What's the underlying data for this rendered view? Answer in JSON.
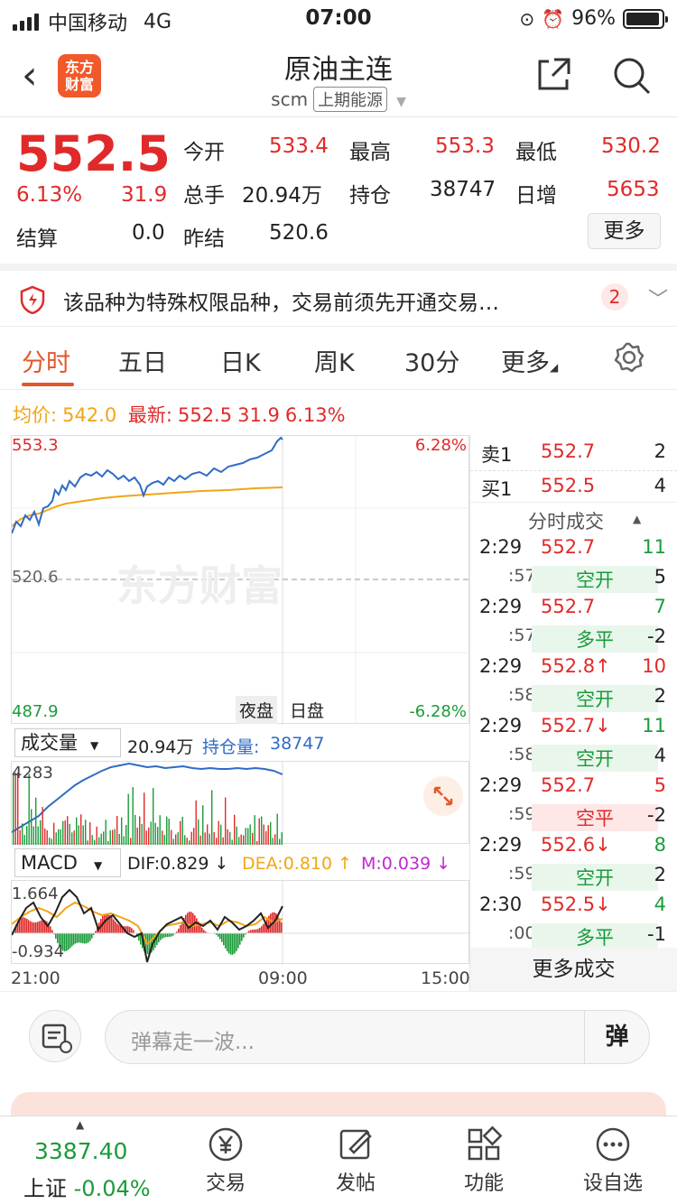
{
  "status_bar": {
    "carrier": "中国移动",
    "network": "4G",
    "time": "07:00",
    "battery": "96%"
  },
  "nav": {
    "logo": "东方\n财富",
    "title": "原油主连",
    "code": "scm",
    "exchange": "上期能源"
  },
  "quote": {
    "price": "552.5",
    "change_pct": "6.13%",
    "change": "31.9",
    "settle_label": "结算",
    "settle": "0.0",
    "open_label": "今开",
    "open": "533.4",
    "volume_label": "总手",
    "volume": "20.94万",
    "prev_settle_label": "昨结",
    "prev_settle": "520.6",
    "high_label": "最高",
    "high": "553.3",
    "oi_label": "持仓",
    "oi": "38747",
    "low_label": "最低",
    "low": "530.2",
    "daily_inc_label": "日增",
    "daily_inc": "5653",
    "more_label": "更多"
  },
  "notice": {
    "text": "该品种为特殊权限品种，交易前须先开通交易…",
    "badge": "2"
  },
  "tabs": [
    "分时",
    "五日",
    "日K",
    "周K",
    "30分",
    "更多"
  ],
  "avg_line": {
    "avg_label": "均价:",
    "avg": "542.0",
    "latest_label": "最新:",
    "latest": "552.5",
    "chg": "31.9",
    "pct": "6.13%"
  },
  "chart": {
    "top_left": "553.3",
    "mid_left": "520.6",
    "bottom_left": "487.9",
    "top_right": "6.28%",
    "bottom_right": "-6.28%",
    "watermark": "东方财富",
    "night": "夜盘",
    "day": "日盘",
    "vol_selector": "成交量",
    "vol_value": "20.94万",
    "oi_label": "持仓量:",
    "oi_value": "38747",
    "vol_max": "4283",
    "macd_selector": "MACD",
    "dif": "DIF:0.829 ↓",
    "dea": "DEA:0.810 ↑",
    "m": "M:0.039 ↓",
    "macd_top": "1.664",
    "macd_bottom": "-0.934",
    "x_labels": [
      "21:00",
      "09:00",
      "15:00"
    ]
  },
  "book": {
    "sell_label": "卖1",
    "sell_price": "552.7",
    "sell_qty": "2",
    "buy_label": "买1",
    "buy_price": "552.5",
    "buy_qty": "4",
    "ticks_title": "分时成交"
  },
  "ticks": [
    {
      "time": "2:29",
      "price": "552.7",
      "qty": "11",
      "type": ":57",
      "action": "空开",
      "n": "5"
    },
    {
      "time": "2:29",
      "price": "552.7",
      "qty": "7",
      "type": ":57",
      "action": "多平",
      "n": "-2"
    },
    {
      "time": "2:29",
      "price": "552.8↑",
      "qty": "10",
      "type": ":58",
      "action": "空开",
      "n": "2"
    },
    {
      "time": "2:29",
      "price": "552.7↓",
      "qty": "11",
      "type": ":58",
      "action": "空开",
      "n": "4"
    },
    {
      "time": "2:29",
      "price": "552.7",
      "qty": "5",
      "type": ":59",
      "action": "空平",
      "n": "-2"
    },
    {
      "time": "2:29",
      "price": "552.6↓",
      "qty": "8",
      "type": ":59",
      "action": "空开",
      "n": "2"
    },
    {
      "time": "2:30",
      "price": "552.5↓",
      "qty": "4",
      "type": ":00",
      "action": "多平",
      "n": "-1"
    }
  ],
  "more_trades": "更多成交",
  "comment": {
    "placeholder": "弹幕走一波...",
    "dan": "弹"
  },
  "tabbar": {
    "index_value": "3387.40",
    "index_name": "上证",
    "index_pct": "-0.04%",
    "items": [
      "交易",
      "发帖",
      "功能",
      "设自选"
    ]
  },
  "colors": {
    "up": "#e02a2a",
    "down": "#1a9b3a",
    "accent": "#e2572a",
    "avg": "#f2a516",
    "price_line": "#2f6cc4"
  }
}
